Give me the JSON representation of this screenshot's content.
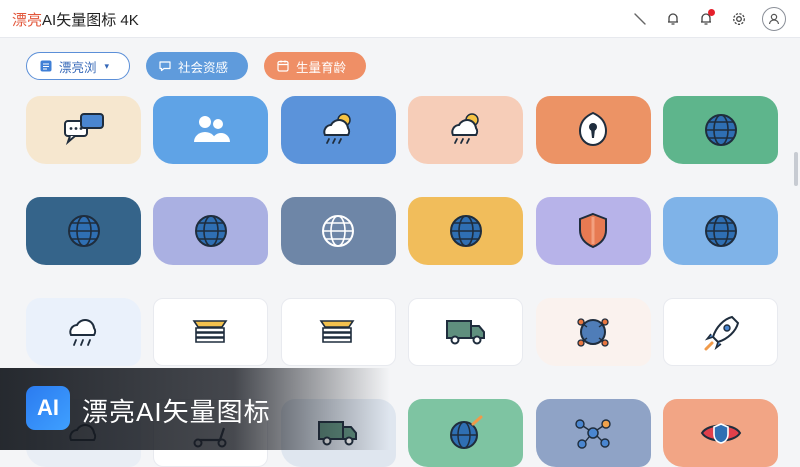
{
  "app": {
    "brand": "漂亮",
    "title_rest": "AI矢量图标 4K"
  },
  "topbar": {
    "icons": [
      "slash-icon",
      "bell-icon",
      "bell-notification-icon",
      "gear-icon",
      "avatar-icon"
    ],
    "notification_dot": true
  },
  "filters": [
    {
      "label": "漂亮浏",
      "icon": "app-icon",
      "style": "outline",
      "has_dropdown": true
    },
    {
      "label": "社会资感",
      "icon": "chat-icon",
      "style": "blue"
    },
    {
      "label": "生量育龄",
      "icon": "calendar-icon",
      "style": "orange"
    }
  ],
  "tiles": [
    {
      "icon": "chat-bubbles-icon",
      "bg": "#f6e7cf"
    },
    {
      "icon": "users-icon",
      "bg": "#5fa3e6"
    },
    {
      "icon": "sun-cloud-rain-icon",
      "bg": "#5b93da"
    },
    {
      "icon": "sun-cloud-rain-icon",
      "bg": "#f6cdb8"
    },
    {
      "icon": "keyhole-badge-icon",
      "bg": "#ec9365"
    },
    {
      "icon": "globe-icon",
      "bg": "#5eb58c"
    },
    {
      "icon": "globe-icon",
      "bg": "#35648a"
    },
    {
      "icon": "globe-icon",
      "bg": "#aab0e2"
    },
    {
      "icon": "globe-white-icon",
      "bg": "#6e86a7"
    },
    {
      "icon": "globe-icon",
      "bg": "#f1bd5b"
    },
    {
      "icon": "shield-icon",
      "bg": "#b7b3e9"
    },
    {
      "icon": "globe-icon",
      "bg": "#7fb3e8"
    },
    {
      "icon": "cloud-rain-icon",
      "bg": "#eaf1fb"
    },
    {
      "icon": "stacked-papers-icon",
      "bg": "#ffffff"
    },
    {
      "icon": "stacked-papers-icon",
      "bg": "#ffffff"
    },
    {
      "icon": "truck-icon",
      "bg": "#ffffff"
    },
    {
      "icon": "network-globe-icon",
      "bg": "#faf2ee"
    },
    {
      "icon": "rocket-icon",
      "bg": "#ffffff"
    },
    {
      "icon": "cloud-icon",
      "bg": "#e9eef5"
    },
    {
      "icon": "scooter-icon",
      "bg": "#ffffff"
    },
    {
      "icon": "truck-icon",
      "bg": "#dfe6ef"
    },
    {
      "icon": "globe-rocket-icon",
      "bg": "#7ec4a2"
    },
    {
      "icon": "network-icon",
      "bg": "#8fa3c6"
    },
    {
      "icon": "eye-shield-icon",
      "bg": "#f2a585"
    }
  ],
  "watermark": {
    "logo": "AI",
    "text": "漂亮AI矢量图标"
  }
}
